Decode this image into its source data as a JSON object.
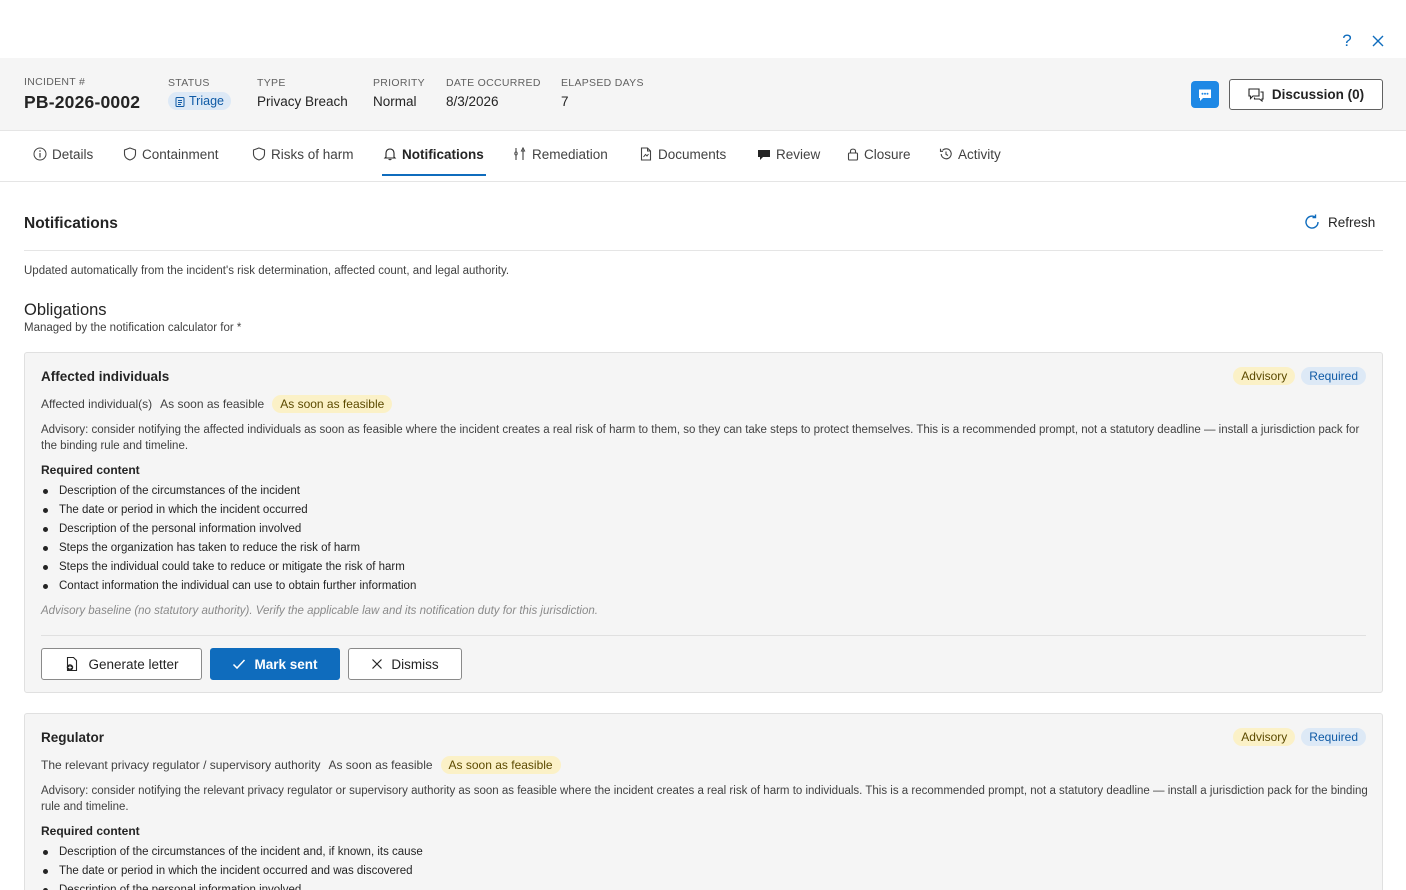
{
  "topbar": {
    "help_icon": "?"
  },
  "header": {
    "incident_label": "INCIDENT #",
    "incident_value": "PB-2026-0002",
    "status_label": "STATUS",
    "status_value": "Triage",
    "type_label": "TYPE",
    "type_value": "Privacy Breach",
    "priority_label": "PRIORITY",
    "priority_value": "Normal",
    "date_label": "DATE OCCURRED",
    "date_value": "8/3/2026",
    "elapsed_label": "ELAPSED DAYS",
    "elapsed_value": "7",
    "discussion_label": "Discussion (0)"
  },
  "tabs": [
    {
      "label": "Details",
      "icon": "info-icon"
    },
    {
      "label": "Containment",
      "icon": "shield-icon"
    },
    {
      "label": "Risks of harm",
      "icon": "shield-icon"
    },
    {
      "label": "Notifications",
      "icon": "bell-icon",
      "active": true
    },
    {
      "label": "Remediation",
      "icon": "tools-icon"
    },
    {
      "label": "Documents",
      "icon": "document-icon"
    },
    {
      "label": "Review",
      "icon": "review-icon"
    },
    {
      "label": "Closure",
      "icon": "lock-icon"
    },
    {
      "label": "Activity",
      "icon": "history-icon"
    }
  ],
  "main": {
    "title": "Notifications",
    "refresh_label": "Refresh",
    "description": "Updated automatically from the incident's risk determination, affected count, and legal authority.",
    "obligations_title": "Obligations",
    "obligations_subtitle": "Managed by the notification calculator for *"
  },
  "cards": [
    {
      "title": "Affected individuals",
      "badge_advisory": "Advisory",
      "badge_required": "Required",
      "recipient": "Affected individual(s)",
      "timing": "As soon as feasible",
      "timing_badge": "As soon as feasible",
      "advisory_text": "Advisory: consider notifying the affected individuals as soon as feasible where the incident creates a real risk of harm to them, so they can take steps to protect themselves. This is a recommended prompt, not a statutory deadline — install a jurisdiction pack for the binding rule and timeline.",
      "required_content_label": "Required content",
      "required_content": [
        "Description of the circumstances of the incident",
        "The date or period in which the incident occurred",
        "Description of the personal information involved",
        "Steps the organization has taken to reduce the risk of harm",
        "Steps the individual could take to reduce or mitigate the risk of harm",
        "Contact information the individual can use to obtain further information"
      ],
      "baseline_note": "Advisory baseline (no statutory authority). Verify the applicable law and its notification duty for this jurisdiction.",
      "actions": {
        "generate": "Generate letter",
        "mark_sent": "Mark sent",
        "dismiss": "Dismiss"
      }
    },
    {
      "title": "Regulator",
      "badge_advisory": "Advisory",
      "badge_required": "Required",
      "recipient": "The relevant privacy regulator / supervisory authority",
      "timing": "As soon as feasible",
      "timing_badge": "As soon as feasible",
      "advisory_text": "Advisory: consider notifying the relevant privacy regulator or supervisory authority as soon as feasible where the incident creates a real risk of harm to individuals. This is a recommended prompt, not a statutory deadline — install a jurisdiction pack for the binding rule and timeline.",
      "required_content_label": "Required content",
      "required_content": [
        "Description of the circumstances of the incident and, if known, its cause",
        "The date or period in which the incident occurred and was discovered",
        "Description of the personal information involved"
      ]
    }
  ]
}
